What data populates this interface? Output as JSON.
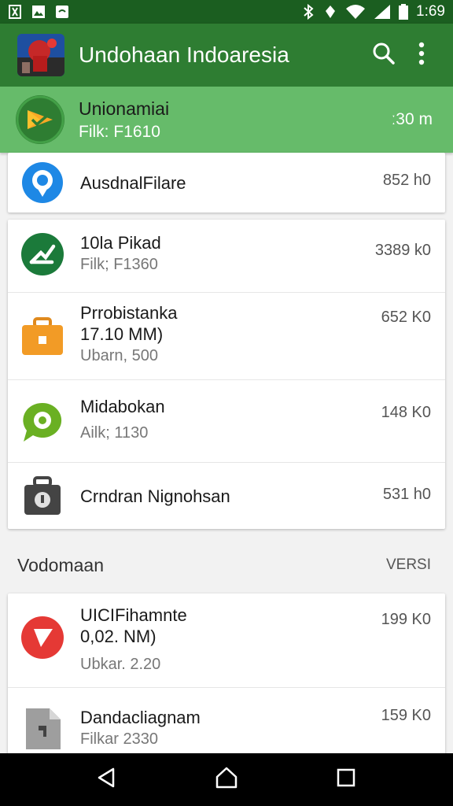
{
  "status_bar": {
    "time": "1:69",
    "icons": [
      "notification-icon",
      "image-icon",
      "message-icon",
      "bluetooth-icon",
      "data-icon",
      "wifi-icon",
      "signal-icon",
      "battery-icon"
    ]
  },
  "app_bar": {
    "title": "Undohaan Indoaresia",
    "actions": [
      "search-icon",
      "more-vert-icon"
    ]
  },
  "featured": {
    "title": "Unionamiai",
    "sub": "Filk: F1610",
    "size": "ː30 m"
  },
  "card1": {
    "items": [
      {
        "title": "AusdnalFilare",
        "size": "852 h0"
      }
    ]
  },
  "card2": {
    "items": [
      {
        "title": "10la Pikad",
        "sub": "Filk; F1360",
        "size": "3389 k0"
      },
      {
        "title": "Prrobistanka",
        "title2": "17.10 MM)",
        "sub": "Ubarn, 500",
        "size": "652 K0"
      },
      {
        "title": "Midabokan",
        "sub": "Ailk; 1130",
        "size": "148 K0"
      },
      {
        "title": "Crndran Nignohsan",
        "size": "531 h0"
      }
    ]
  },
  "section": {
    "label": "Vodomaan",
    "action": "VERSI"
  },
  "card3": {
    "items": [
      {
        "title": "UICIFihamnte",
        "title2": "0,02. NM)",
        "sub": "Ubkar. 2.20",
        "size": "199 K0"
      },
      {
        "title": "Dandacliagnam",
        "sub": "Filkar 2330",
        "size": "159 K0"
      }
    ]
  },
  "colors": {
    "appbar": "#2e7d32",
    "statusbar": "#1b5e20",
    "featured": "#66bb6a"
  }
}
